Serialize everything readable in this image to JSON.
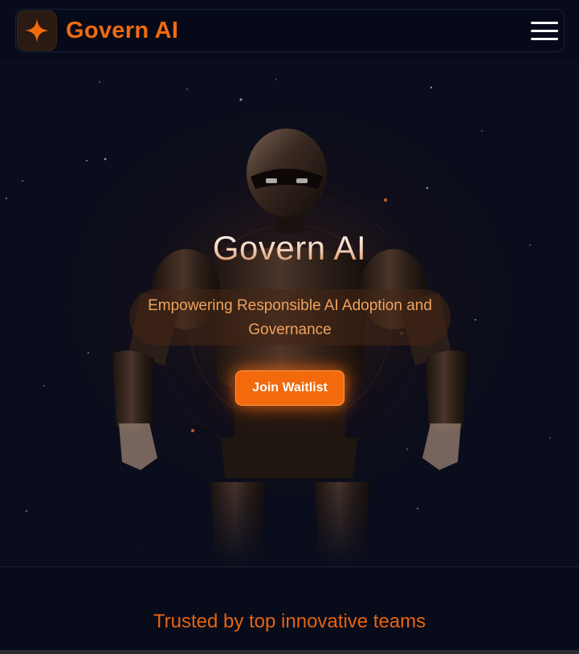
{
  "navbar": {
    "brand_name": "Govern AI",
    "logo_icon": "four-point-star-icon",
    "menu_icon": "hamburger-menu-icon"
  },
  "hero": {
    "title": "Govern AI",
    "tagline": "Empowering Responsible AI Adoption and Governance",
    "cta_label": "Join Waitlist"
  },
  "trusted": {
    "heading": "Trusted by top innovative teams"
  },
  "colors": {
    "accent": "#f26a0c",
    "background": "#070b1a",
    "tagline_text": "#f0a25e"
  }
}
